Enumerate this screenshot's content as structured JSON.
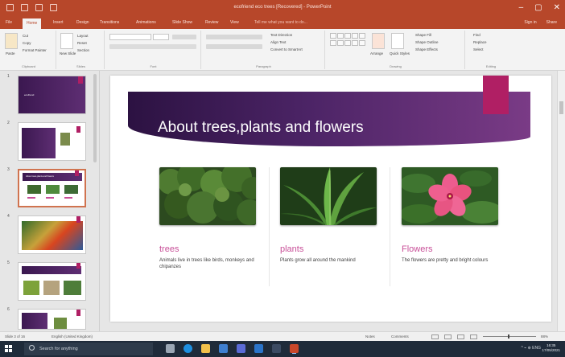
{
  "window": {
    "title": "ecofriend eco trees [Recovered] - PowerPoint",
    "controls": [
      "–",
      "▢",
      "✕"
    ]
  },
  "ribbon": {
    "tabs": [
      "File",
      "Home",
      "Insert",
      "Design",
      "Transitions",
      "Animations",
      "Slide Show",
      "Review",
      "View"
    ],
    "active_tab": "Home",
    "tell_me": "Tell me what you want to do...",
    "sign_in": "Sign in",
    "share": "Share",
    "clipboard": {
      "paste": "Paste",
      "cut": "Cut",
      "copy": "Copy",
      "format_painter": "Format Painter",
      "label": "Clipboard"
    },
    "slides": {
      "new_slide": "New Slide",
      "layout": "Layout",
      "reset": "Reset",
      "section": "Section",
      "label": "Slides"
    },
    "font": {
      "label": "Font"
    },
    "paragraph": {
      "text_direction": "Text Direction",
      "align_text": "Align Text",
      "convert_smartart": "Convert to SmartArt",
      "label": "Paragraph"
    },
    "drawing": {
      "arrange": "Arrange",
      "quick_styles": "Quick Styles",
      "shape_fill": "Shape Fill",
      "shape_outline": "Shape Outline",
      "shape_effects": "Shape Effects",
      "label": "Drawing"
    },
    "editing": {
      "find": "Find",
      "replace": "Replace",
      "select": "Select",
      "label": "Editing"
    }
  },
  "thumbnails": [
    {
      "num": "1",
      "title": "ecofriend"
    },
    {
      "num": "2",
      "title": ""
    },
    {
      "num": "3",
      "title": "About trees,plants and flowers"
    },
    {
      "num": "4",
      "title": ""
    },
    {
      "num": "5",
      "title": ""
    },
    {
      "num": "6",
      "title": ""
    }
  ],
  "slide": {
    "title": "About trees,plants and flowers",
    "columns": [
      {
        "heading": "trees",
        "text": "Animals live in trees like birds, monkeys and chipanzes"
      },
      {
        "heading": "plants",
        "text": "Plants grow all around the mankind"
      },
      {
        "heading": "Flowers",
        "text": "The flowers are pretty and bright colours"
      }
    ]
  },
  "status": {
    "slide_info": "Slide 3 of 16",
    "language": "English (United Kingdom)",
    "notes": "Notes",
    "comments": "Comments",
    "zoom": "88%"
  },
  "taskbar": {
    "search_placeholder": "Search for anything",
    "tray": "^  ⌁  ⊕  ENG",
    "time": "16:35",
    "date": "17/05/2021"
  },
  "colors": {
    "accent": "#b7472a",
    "banner_dark": "#2c1242",
    "banner_light": "#7a3b86",
    "pink_square": "#b01f64",
    "heading_pink": "#c84f98"
  }
}
